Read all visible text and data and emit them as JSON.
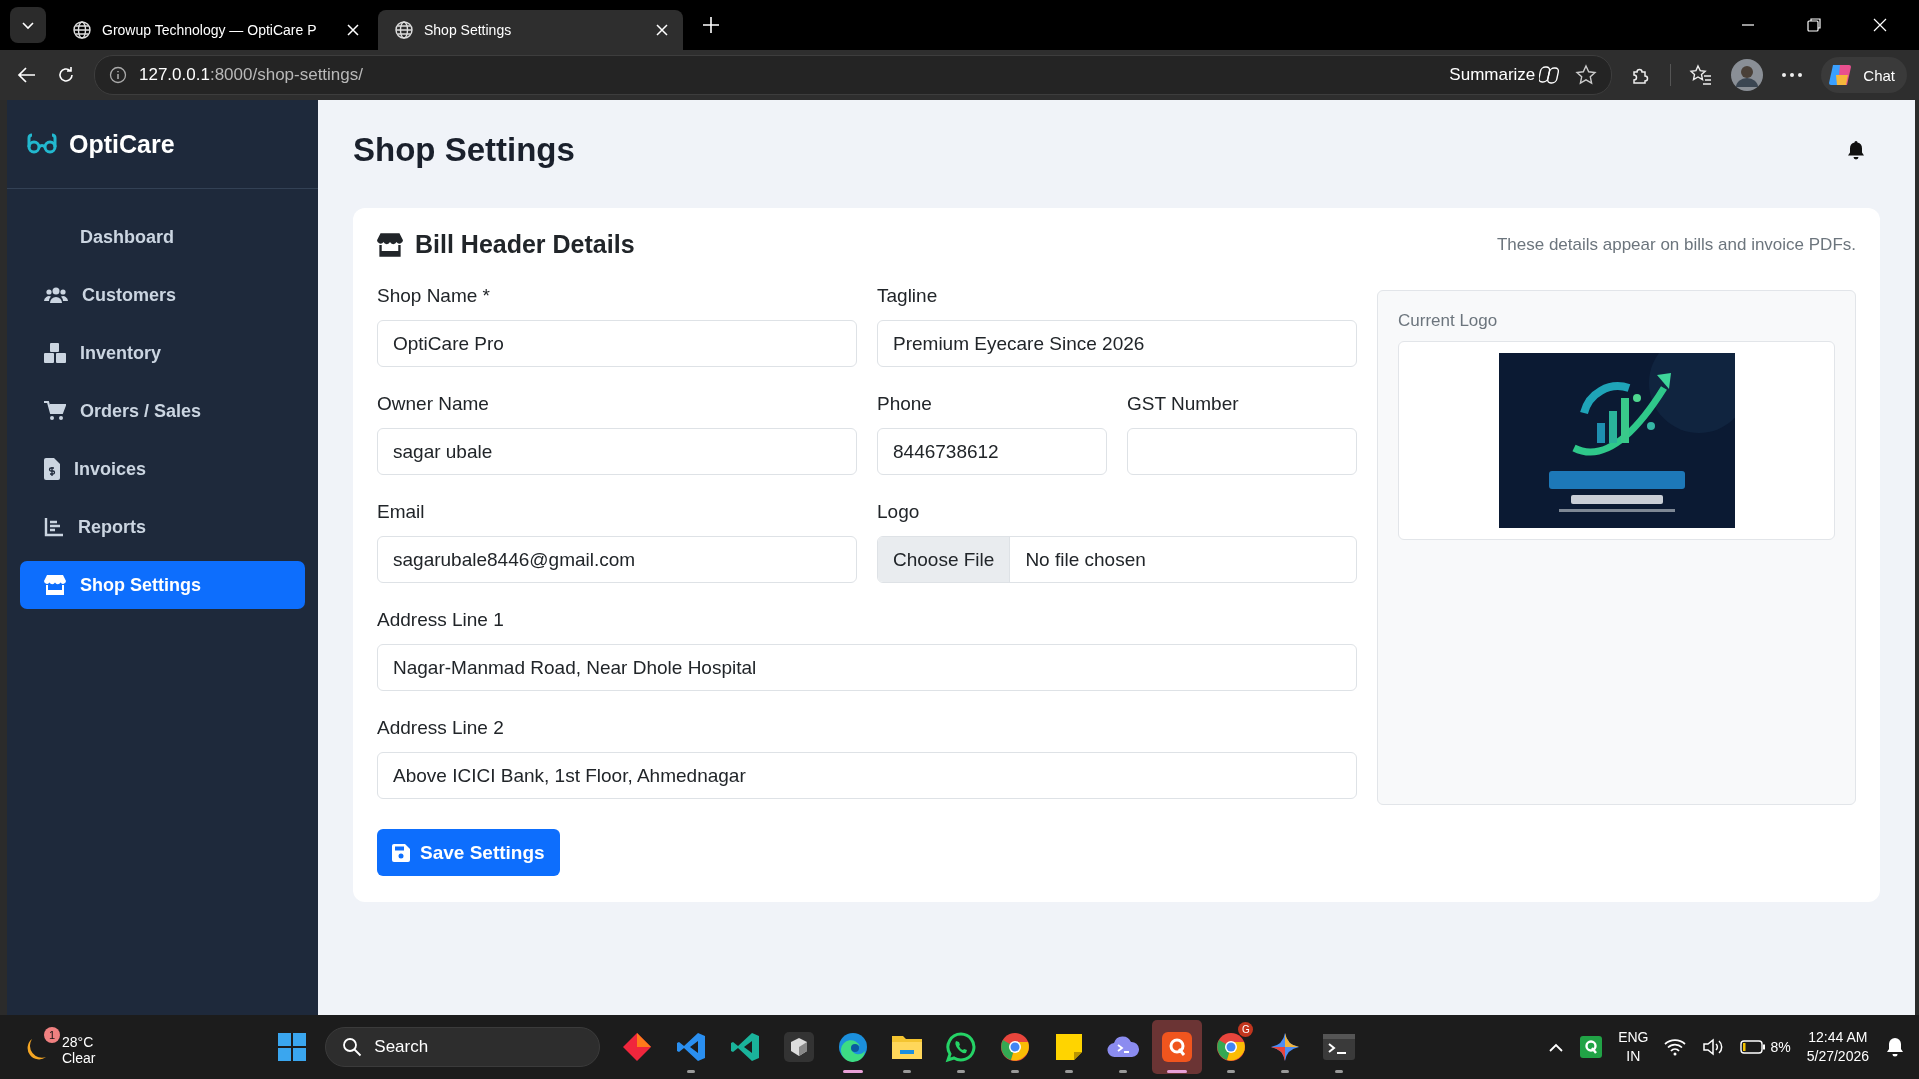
{
  "browser": {
    "tabs": [
      {
        "title": "Growup Technology — OptiCare P",
        "selected": false
      },
      {
        "title": "Shop Settings",
        "selected": true
      }
    ],
    "address": {
      "host": "127.0.0.1",
      "path": ":8000/shop-settings/"
    },
    "summarize": "Summarize",
    "chat": "Chat"
  },
  "sidebar": {
    "brand": "OptiCare",
    "items": [
      {
        "label": "Dashboard",
        "kind": "none",
        "selected": false
      },
      {
        "label": "Customers",
        "kind": "users",
        "selected": false
      },
      {
        "label": "Inventory",
        "kind": "boxes",
        "selected": false
      },
      {
        "label": "Orders / Sales",
        "kind": "cart",
        "selected": false
      },
      {
        "label": "Invoices",
        "kind": "invoice",
        "selected": false
      },
      {
        "label": "Reports",
        "kind": "chart",
        "selected": false
      },
      {
        "label": "Shop Settings",
        "kind": "store",
        "selected": true
      }
    ]
  },
  "header": {
    "title": "Shop Settings"
  },
  "card": {
    "title": "Bill Header Details",
    "note": "These details appear on bills and invoice PDFs.",
    "shop_name": {
      "label": "Shop Name *",
      "value": "OptiCare Pro"
    },
    "tagline": {
      "label": "Tagline",
      "value": "Premium Eyecare Since 2026"
    },
    "owner_name": {
      "label": "Owner Name",
      "value": "sagar ubale"
    },
    "phone": {
      "label": "Phone",
      "value": "8446738612"
    },
    "gst_number": {
      "label": "GST Number"
    },
    "email": {
      "label": "Email",
      "value": "sagarubale8446@gmail.com"
    },
    "logo": {
      "label": "Logo",
      "button": "Choose File",
      "status": "No file chosen"
    },
    "address_line_1": {
      "label": "Address Line 1",
      "value": "Nagar-Manmad Road, Near Dhole Hospital"
    },
    "address_line_2": {
      "label": "Address Line 2",
      "value": "Above ICICI Bank, 1st Floor, Ahmednagar"
    },
    "logo_panel": {
      "label": "Current Logo"
    },
    "save_button": "Save Settings"
  },
  "taskbar": {
    "weather": {
      "badge": "1",
      "temperature": "28°C",
      "condition": "Clear"
    },
    "search": "Search",
    "apps": [
      {
        "kind": "gem",
        "running": false,
        "active": false
      },
      {
        "kind": "vscode",
        "running": true,
        "active": false
      },
      {
        "kind": "vscode-insiders",
        "running": false,
        "active": false
      },
      {
        "kind": "cube",
        "running": false,
        "active": false
      },
      {
        "kind": "edge",
        "running": true,
        "active": true
      },
      {
        "kind": "folder",
        "running": true,
        "active": false
      },
      {
        "kind": "whatsapp",
        "running": true,
        "active": false
      },
      {
        "kind": "chrome",
        "running": true,
        "active": false
      },
      {
        "kind": "note",
        "running": true,
        "active": false
      },
      {
        "kind": "cloud",
        "running": true,
        "active": false
      },
      {
        "kind": "q",
        "running": true,
        "active": true
      },
      {
        "kind": "chrome",
        "running": true,
        "active": false,
        "badge": "G"
      },
      {
        "kind": "star",
        "running": true,
        "active": false
      },
      {
        "kind": "terminal",
        "running": true,
        "active": false
      }
    ],
    "tray": {
      "language": "ENG",
      "region": "IN",
      "battery": "8%",
      "time": "12:44 AM",
      "date": "5/27/2026"
    }
  }
}
